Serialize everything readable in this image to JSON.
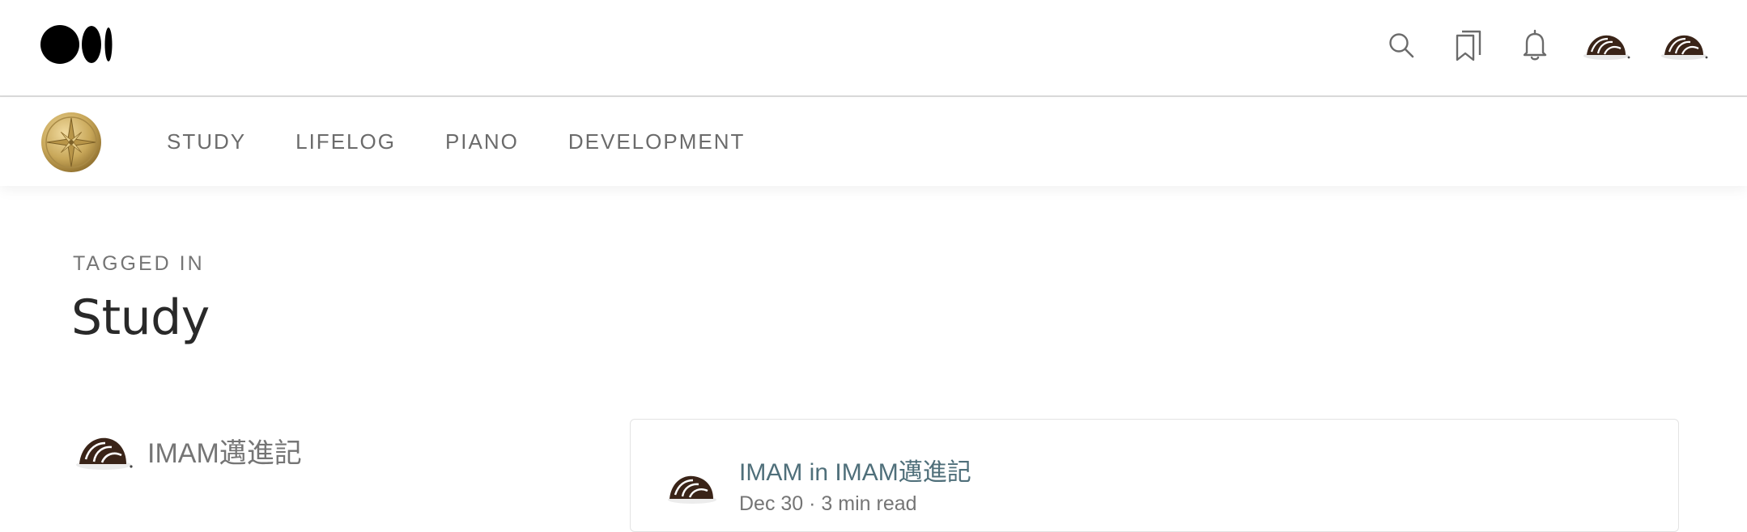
{
  "topbar": {
    "logo_name": "medium-logo",
    "icons": [
      "search-icon",
      "bookmarks-icon",
      "bell-icon"
    ],
    "colors": {
      "border": "#d9d9d9",
      "icon": "#6b6b6b"
    }
  },
  "publication_nav": {
    "items": [
      {
        "label": "STUDY"
      },
      {
        "label": "LIFELOG"
      },
      {
        "label": "PIANO"
      },
      {
        "label": "DEVELOPMENT"
      }
    ]
  },
  "tag_header": {
    "label": "TAGGED IN",
    "title": "Study"
  },
  "publication_row": {
    "name": "IMAM邁進記"
  },
  "post_card": {
    "author": "IMAM",
    "in_word": "in",
    "publication": "IMAM邁進記",
    "meta": "Dec 30 · 3 min read"
  },
  "colors": {
    "text_dark": "#292929",
    "text_muted": "#757575",
    "link_teal": "#4f6f7a",
    "gold": "#c9a85a"
  }
}
